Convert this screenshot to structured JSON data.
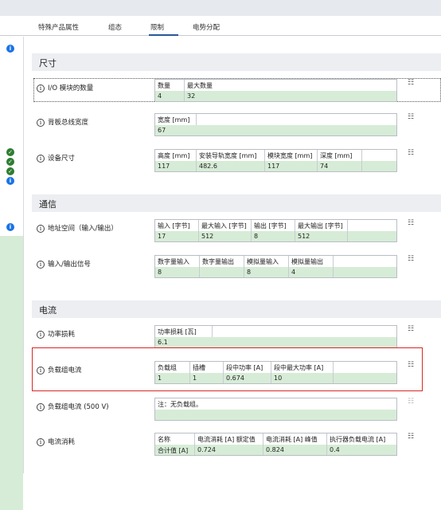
{
  "tabs": [
    "特殊产品属性",
    "组态",
    "限制",
    "电势分配"
  ],
  "sections": {
    "size": "尺寸",
    "comm": "通信",
    "current": "电流"
  },
  "rows": {
    "io_count": {
      "label": "I/O 模块的数量",
      "headers": [
        "数量",
        "最大数量"
      ],
      "values": [
        "4",
        "32"
      ]
    },
    "backplane_width": {
      "label": "背板总线宽度",
      "headers": [
        "宽度 [mm]"
      ],
      "values": [
        "67"
      ]
    },
    "device_size": {
      "label": "设备尺寸",
      "headers": [
        "高度 [mm]",
        "安装导轨宽度 [mm]",
        "模块宽度 [mm]",
        "深度 [mm]"
      ],
      "values": [
        "117",
        "482.6",
        "117",
        "74"
      ]
    },
    "address_space": {
      "label": "地址空间（输入/输出）",
      "headers": [
        "输入 [字节]",
        "最大输入 [字节]",
        "输出 [字节]",
        "最大输出 [字节]"
      ],
      "values": [
        "17",
        "512",
        "8",
        "512"
      ]
    },
    "io_signals": {
      "label": "输入/输出信号",
      "headers": [
        "数字量输入",
        "数字量输出",
        "模拟量输入",
        "模拟量输出"
      ],
      "values": [
        "8",
        "",
        "8",
        "4"
      ]
    },
    "power_loss": {
      "label": "功率损耗",
      "headers": [
        "功率损耗 [瓦]"
      ],
      "values": [
        "6.1"
      ]
    },
    "load_group_current": {
      "label": "负载组电流",
      "headers": [
        "负载组",
        "插槽",
        "段中功率 [A]",
        "段中最大功率 [A]"
      ],
      "values": [
        "1",
        "1",
        "0.674",
        "10"
      ]
    },
    "load_group_current_500": {
      "label": "负载组电流 (500 V)",
      "headers": [
        "注：无负载组。"
      ],
      "values": [
        ""
      ]
    },
    "current_consumption": {
      "label": "电流消耗",
      "headers": [
        "名称",
        "电流消耗 [A] 额定值",
        "电流消耗 [A] 峰值",
        "执行器负载电流 [A]"
      ],
      "values": [
        "合计值 [A]",
        "0.724",
        "0.824",
        "0.4"
      ]
    }
  },
  "status_icons": [
    "info-icon",
    "check-icon",
    "check-icon",
    "check-icon",
    "info-icon",
    "info-icon"
  ],
  "colors": {
    "accent": "#2b579a",
    "value_row": "#d7ecd7",
    "highlight": "#d62828"
  }
}
